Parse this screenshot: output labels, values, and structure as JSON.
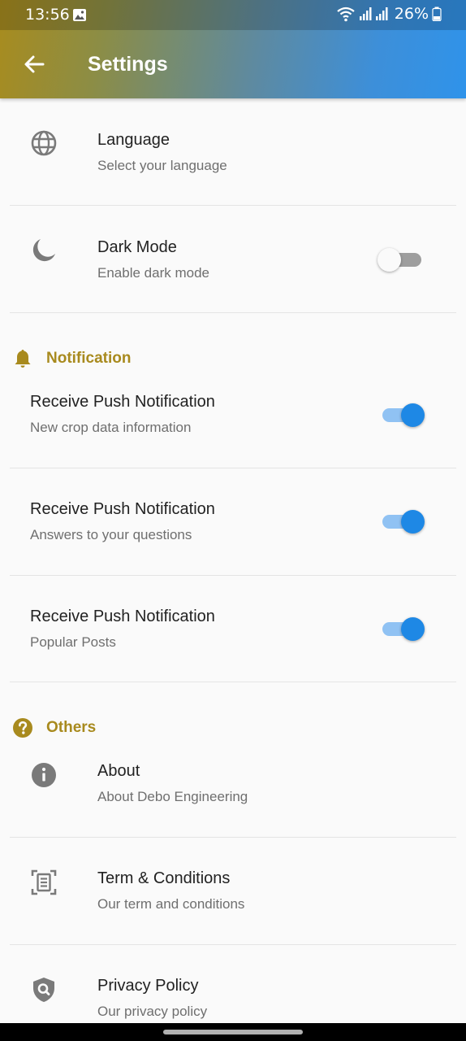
{
  "status": {
    "time": "13:56",
    "battery": "26%"
  },
  "appbar": {
    "title": "Settings"
  },
  "general": [
    {
      "title": "Language",
      "subtitle": "Select your language",
      "icon": "globe-icon"
    },
    {
      "title": "Dark Mode",
      "subtitle": "Enable dark mode",
      "icon": "moon-icon",
      "toggle": false
    }
  ],
  "notification_section": {
    "label": "Notification",
    "icon": "bell-icon"
  },
  "notifications": [
    {
      "title": "Receive Push Notification",
      "subtitle": "New crop data information",
      "toggle": true
    },
    {
      "title": "Receive Push Notification",
      "subtitle": "Answers to your questions",
      "toggle": true
    },
    {
      "title": "Receive Push Notification",
      "subtitle": "Popular Posts",
      "toggle": true
    }
  ],
  "others_section": {
    "label": "Others",
    "icon": "help-circle-icon"
  },
  "others": [
    {
      "title": "About",
      "subtitle": "About Debo Engineering",
      "icon": "info-icon"
    },
    {
      "title": "Term & Conditions",
      "subtitle": "Our term and conditions",
      "icon": "document-icon"
    },
    {
      "title": "Privacy Policy",
      "subtitle": "Our privacy policy",
      "icon": "shield-search-icon"
    }
  ],
  "colors": {
    "accent": "#1e88e5",
    "section": "#a88a1e",
    "icon": "#7a7a7a"
  }
}
